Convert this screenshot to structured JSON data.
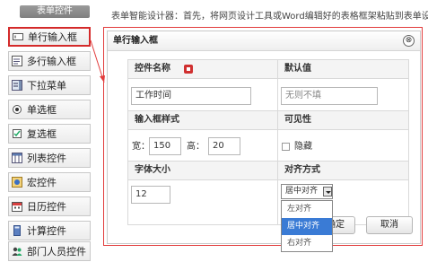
{
  "sidebar": {
    "title": "表单控件",
    "items": [
      {
        "label": "单行输入框",
        "icon": "text-input-icon"
      },
      {
        "label": "多行输入框",
        "icon": "textarea-icon"
      },
      {
        "label": "下拉菜单",
        "icon": "dropdown-icon"
      },
      {
        "label": "单选框",
        "icon": "radio-icon"
      },
      {
        "label": "复选框",
        "icon": "checkbox-icon"
      },
      {
        "label": "列表控件",
        "icon": "list-icon"
      },
      {
        "label": "宏控件",
        "icon": "macro-icon"
      },
      {
        "label": "日历控件",
        "icon": "calendar-icon"
      },
      {
        "label": "计算控件",
        "icon": "calculator-icon"
      },
      {
        "label": "部门人员控件",
        "icon": "people-icon"
      }
    ]
  },
  "intro_text": "表单智能设计器：首先，将网页设计工具或Word编辑好的表格框架粘贴到表单设计区。然后，",
  "dialog": {
    "title": "单行输入框",
    "close_symbol": "⊗",
    "field_name_label": "控件名称",
    "field_name_value": "工作时间",
    "default_label": "默认值",
    "default_placeholder": "无则不填",
    "style_label": "输入框样式",
    "width_label": "宽：",
    "width_value": "150",
    "height_label": "高：",
    "height_value": "20",
    "visibility_label": "可见性",
    "hidden_label": "隐藏",
    "font_size_label": "字体大小",
    "font_size_value": "12",
    "align_label": "对齐方式",
    "align_selected": "居中对齐",
    "align_options": [
      "左对齐",
      "居中对齐",
      "右对齐"
    ],
    "ok_label": "确定",
    "cancel_label": "取消"
  }
}
